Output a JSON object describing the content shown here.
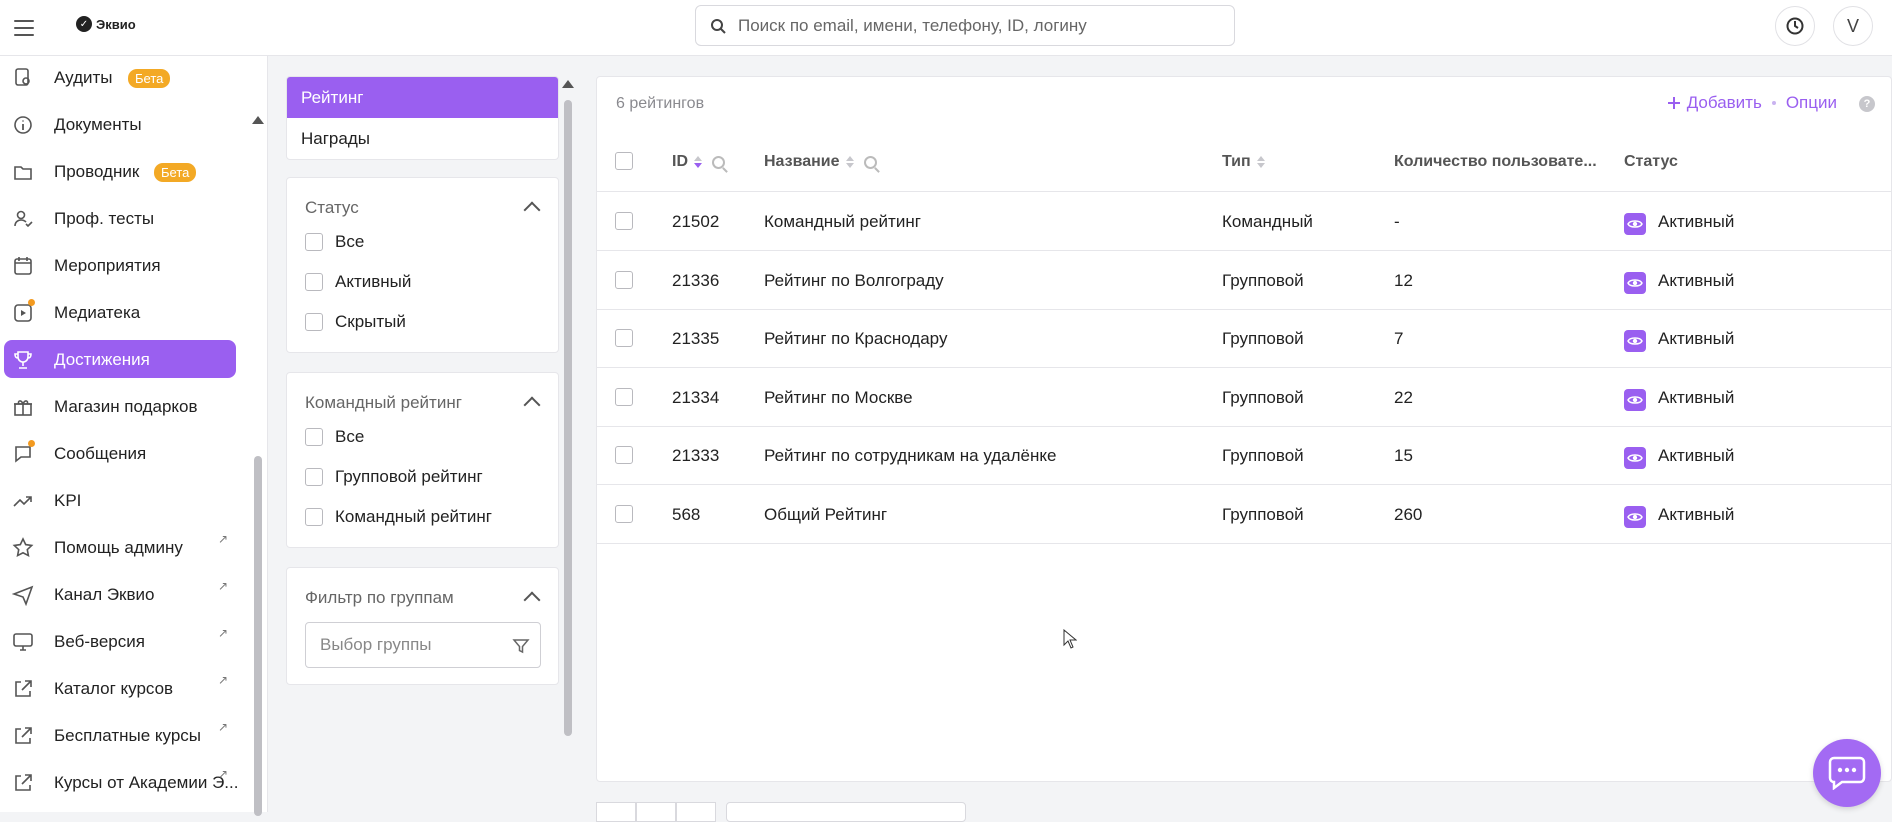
{
  "header": {
    "logo_text": "Эквио",
    "search_placeholder": "Поиск по email, имени, телефону, ID, логину",
    "avatar_letter": "V"
  },
  "sidebar": {
    "items": [
      {
        "label": "Аудиты",
        "icon": "audit-icon",
        "badge": "Бета"
      },
      {
        "label": "Документы",
        "icon": "info-icon"
      },
      {
        "label": "Проводник",
        "icon": "folder-icon",
        "badge": "Бета"
      },
      {
        "label": "Проф. тесты",
        "icon": "user-check-icon"
      },
      {
        "label": "Мероприятия",
        "icon": "calendar-icon"
      },
      {
        "label": "Медиатека",
        "icon": "media-icon"
      },
      {
        "label": "Достижения",
        "icon": "trophy-icon",
        "active": true
      },
      {
        "label": "Магазин подарков",
        "icon": "gift-icon"
      },
      {
        "label": "Сообщения",
        "icon": "chat-icon"
      },
      {
        "label": "KPI",
        "icon": "trend-icon"
      },
      {
        "label": "Помощь админу",
        "icon": "star-icon",
        "external": true
      },
      {
        "label": "Канал Эквио",
        "icon": "send-icon",
        "external": true
      },
      {
        "label": "Веб-версия",
        "icon": "monitor-icon",
        "external": true
      },
      {
        "label": "Каталог курсов",
        "icon": "external-link-icon",
        "external": true
      },
      {
        "label": "Бесплатные курсы",
        "icon": "external-link-icon",
        "external": true
      },
      {
        "label": "Курсы от Академии Э...",
        "icon": "external-link-icon",
        "external": true
      }
    ]
  },
  "filters": {
    "tabs": [
      "Рейтинг",
      "Награды"
    ],
    "status": {
      "title": "Статус",
      "options": [
        "Все",
        "Активный",
        "Скрытый"
      ]
    },
    "team": {
      "title": "Командный рейтинг",
      "options": [
        "Все",
        "Групповой рейтинг",
        "Командный рейтинг"
      ]
    },
    "groups": {
      "title": "Фильтр по группам",
      "placeholder": "Выбор группы"
    }
  },
  "table": {
    "count_label": "6 рейтингов",
    "add_label": "Добавить",
    "options_label": "Опции",
    "help_label": "?",
    "columns": {
      "id": "ID",
      "name": "Название",
      "type": "Тип",
      "users": "Количество пользовате...",
      "status": "Статус"
    },
    "rows": [
      {
        "id": "21502",
        "name": "Командный рейтинг",
        "type": "Командный",
        "users": "-",
        "status": "Активный"
      },
      {
        "id": "21336",
        "name": "Рейтинг по Волгограду",
        "type": "Групповой",
        "users": "12",
        "status": "Активный"
      },
      {
        "id": "21335",
        "name": "Рейтинг по Краснодару",
        "type": "Групповой",
        "users": "7",
        "status": "Активный"
      },
      {
        "id": "21334",
        "name": "Рейтинг по Москве",
        "type": "Групповой",
        "users": "22",
        "status": "Активный"
      },
      {
        "id": "21333",
        "name": "Рейтинг по сотрудникам на удалёнке",
        "type": "Групповой",
        "users": "15",
        "status": "Активный"
      },
      {
        "id": "568",
        "name": "Общий Рейтинг",
        "type": "Групповой",
        "users": "260",
        "status": "Активный"
      }
    ]
  },
  "colors": {
    "accent": "#9a5ff0",
    "badge": "#f3a925"
  }
}
